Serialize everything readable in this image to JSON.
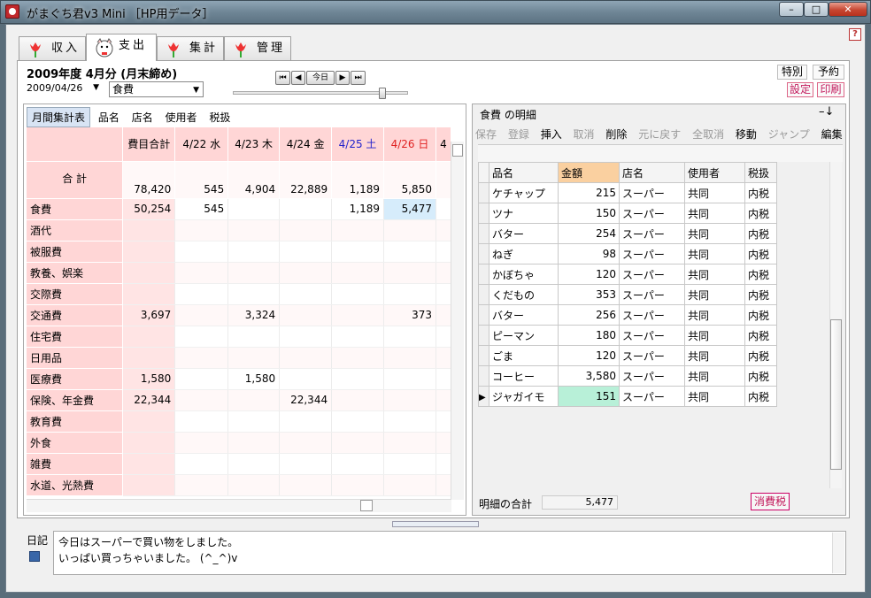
{
  "window": {
    "title": "がまぐち君v3 Mini ［HP用データ］",
    "min": "–",
    "max": "□",
    "close": "✕",
    "help": "?"
  },
  "tabs": [
    {
      "label": "収入"
    },
    {
      "label": "支出"
    },
    {
      "label": "集計"
    },
    {
      "label": "管理"
    }
  ],
  "header": {
    "heading": "2009年度 4月分 (月末締め)",
    "date": "2009/04/26",
    "category": "食費",
    "today": "今日",
    "special": "特別",
    "reserve": "予約",
    "settings": "設定",
    "print": "印刷"
  },
  "left": {
    "tabs": [
      "月間集計表",
      "品名",
      "店名",
      "使用者",
      "税扱"
    ],
    "columns": [
      "費目合計",
      "4/22 水",
      "4/23 木",
      "4/24 金",
      "4/25 土",
      "4/26 日",
      "4"
    ],
    "total_label": "合 計",
    "totals": [
      "78,420",
      "545",
      "4,904",
      "22,889",
      "1,189",
      "5,850"
    ],
    "rows": [
      {
        "label": "食費",
        "vals": [
          "50,254",
          "545",
          "",
          "",
          "1,189",
          "5,477"
        ]
      },
      {
        "label": "酒代",
        "vals": [
          "",
          "",
          "",
          "",
          "",
          ""
        ]
      },
      {
        "label": "被服費",
        "vals": [
          "",
          "",
          "",
          "",
          "",
          ""
        ]
      },
      {
        "label": "教養、娯楽",
        "vals": [
          "",
          "",
          "",
          "",
          "",
          ""
        ]
      },
      {
        "label": "交際費",
        "vals": [
          "",
          "",
          "",
          "",
          "",
          ""
        ]
      },
      {
        "label": "交通費",
        "vals": [
          "3,697",
          "",
          "3,324",
          "",
          "",
          "373"
        ]
      },
      {
        "label": "住宅費",
        "vals": [
          "",
          "",
          "",
          "",
          "",
          ""
        ]
      },
      {
        "label": "日用品",
        "vals": [
          "",
          "",
          "",
          "",
          "",
          ""
        ]
      },
      {
        "label": "医療費",
        "vals": [
          "1,580",
          "",
          "1,580",
          "",
          "",
          ""
        ]
      },
      {
        "label": "保険、年金費",
        "vals": [
          "22,344",
          "",
          "",
          "22,344",
          "",
          ""
        ]
      },
      {
        "label": "教育費",
        "vals": [
          "",
          "",
          "",
          "",
          "",
          ""
        ]
      },
      {
        "label": "外食",
        "vals": [
          "",
          "",
          "",
          "",
          "",
          ""
        ]
      },
      {
        "label": "雑費",
        "vals": [
          "",
          "",
          "",
          "",
          "",
          ""
        ]
      },
      {
        "label": "水道、光熱費",
        "vals": [
          "",
          "",
          "",
          "",
          "",
          ""
        ]
      }
    ]
  },
  "right": {
    "title": "食費 の明細",
    "toolbar": [
      "保存",
      "登録",
      "挿入",
      "取消",
      "削除",
      "元に戻す",
      "全取消",
      "移動",
      "ジャンプ",
      "編集"
    ],
    "columns": [
      "品名",
      "金額",
      "店名",
      "使用者",
      "税扱"
    ],
    "rows": [
      [
        "ケチャップ",
        "215",
        "スーパー",
        "共同",
        "内税"
      ],
      [
        "ツナ",
        "150",
        "スーパー",
        "共同",
        "内税"
      ],
      [
        "バター",
        "254",
        "スーパー",
        "共同",
        "内税"
      ],
      [
        "ねぎ",
        "98",
        "スーパー",
        "共同",
        "内税"
      ],
      [
        "かぼちゃ",
        "120",
        "スーパー",
        "共同",
        "内税"
      ],
      [
        "くだもの",
        "353",
        "スーパー",
        "共同",
        "内税"
      ],
      [
        "バター",
        "256",
        "スーパー",
        "共同",
        "内税"
      ],
      [
        "ピーマン",
        "180",
        "スーパー",
        "共同",
        "内税"
      ],
      [
        "ごま",
        "120",
        "スーパー",
        "共同",
        "内税"
      ],
      [
        "コーヒー",
        "3,580",
        "スーパー",
        "共同",
        "内税"
      ],
      [
        "ジャガイモ",
        "151",
        "スーパー",
        "共同",
        "内税"
      ]
    ],
    "subtotal_label": "明細の合計",
    "subtotal": "5,477",
    "tax_button": "消費税"
  },
  "diary": {
    "label": "日記",
    "line1": "今日はスーパーで買い物をしました。",
    "line2": "いっぱい買っちゃいました。 (^_^)v"
  },
  "colors": {
    "pink": "#ffd6d6",
    "sat": "#2222cc",
    "sun": "#e02020",
    "accent": "#c2185b"
  }
}
